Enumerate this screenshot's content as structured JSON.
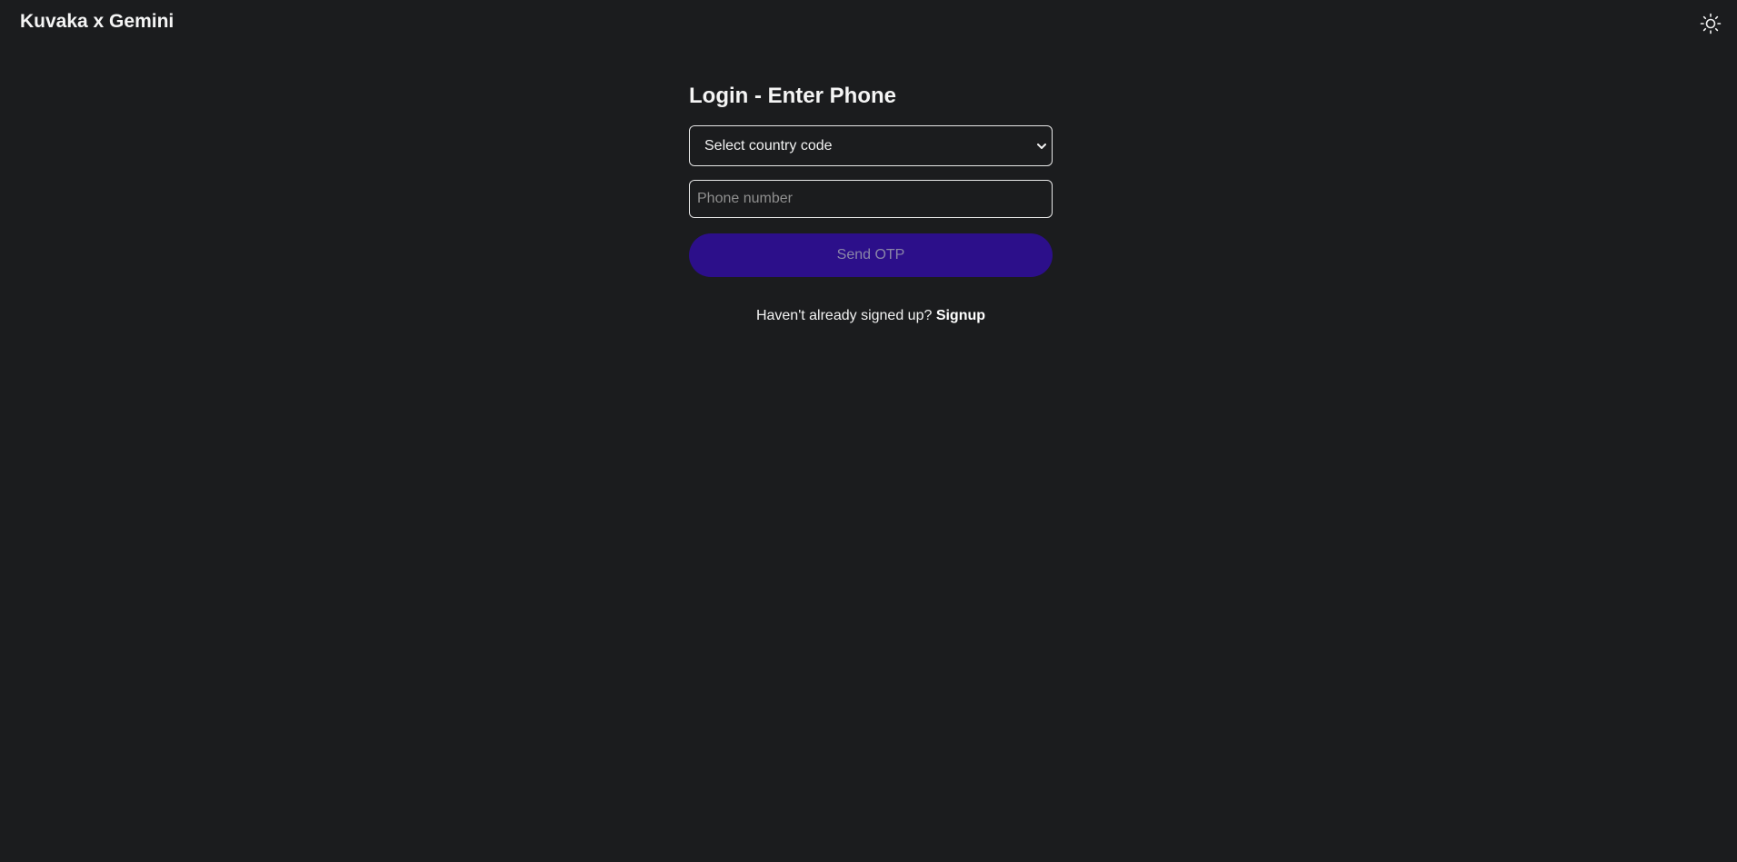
{
  "header": {
    "brand": "Kuvaka x Gemini",
    "theme_icon": "sun-icon"
  },
  "login": {
    "title": "Login - Enter Phone",
    "country_select": {
      "selected": "Select country code"
    },
    "phone": {
      "value": "",
      "placeholder": "Phone number"
    },
    "send_button": "Send OTP",
    "signup_prompt": "Haven't already signed up?",
    "signup_link": "Signup"
  },
  "colors": {
    "background": "#1b1c1e",
    "button": "#2c0f8a",
    "button_text": "#8a86a8"
  }
}
